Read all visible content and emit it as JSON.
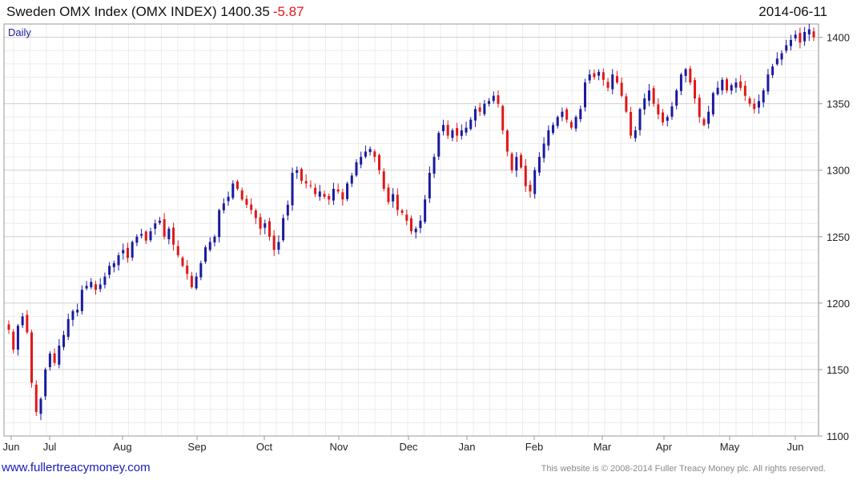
{
  "header": {
    "title": "Sweden OMX Index  (OMX INDEX) 1400.35",
    "change": "-5.87",
    "date": "2014-06-11"
  },
  "footer": {
    "link": "www.fullertreacymoney.com",
    "copyright": "This website is © 2008-2014 Fuller Treacy Money plc. All rights reserved."
  },
  "colors": {
    "up": "#1a1aa0",
    "down": "#e01818",
    "grid": "#d8d8d8",
    "frame": "#999999"
  },
  "chart_data": {
    "type": "candlestick",
    "period_label": "Daily",
    "ylim": [
      1100,
      1410
    ],
    "y_ticks": [
      1100,
      1150,
      1200,
      1250,
      1300,
      1350,
      1400
    ],
    "x_ticks": [
      "Jun",
      "Jul",
      "Aug",
      "Sep",
      "Oct",
      "Nov",
      "Dec",
      "Jan",
      "Feb",
      "Mar",
      "Apr",
      "May",
      "Jun"
    ],
    "grid": true,
    "note": "close values approximated from the plot",
    "closes": [
      1180,
      1165,
      1183,
      1190,
      1178,
      1140,
      1118,
      1128,
      1150,
      1162,
      1155,
      1168,
      1176,
      1188,
      1194,
      1195,
      1210,
      1213,
      1216,
      1210,
      1214,
      1220,
      1228,
      1230,
      1236,
      1240,
      1234,
      1246,
      1250,
      1252,
      1247,
      1254,
      1260,
      1262,
      1250,
      1256,
      1244,
      1236,
      1228,
      1222,
      1212,
      1220,
      1230,
      1242,
      1246,
      1250,
      1270,
      1275,
      1280,
      1290,
      1286,
      1278,
      1274,
      1270,
      1264,
      1256,
      1260,
      1250,
      1240,
      1246,
      1264,
      1274,
      1298,
      1300,
      1292,
      1290,
      1288,
      1282,
      1284,
      1280,
      1278,
      1286,
      1284,
      1278,
      1290,
      1296,
      1306,
      1310,
      1314,
      1316,
      1310,
      1300,
      1286,
      1276,
      1282,
      1270,
      1268,
      1262,
      1254,
      1256,
      1262,
      1278,
      1298,
      1310,
      1328,
      1334,
      1326,
      1330,
      1326,
      1330,
      1332,
      1338,
      1346,
      1344,
      1350,
      1352,
      1356,
      1350,
      1330,
      1314,
      1300,
      1310,
      1302,
      1288,
      1284,
      1300,
      1310,
      1320,
      1330,
      1334,
      1340,
      1344,
      1338,
      1332,
      1340,
      1346,
      1366,
      1372,
      1370,
      1374,
      1368,
      1362,
      1372,
      1366,
      1356,
      1344,
      1326,
      1330,
      1346,
      1354,
      1360,
      1350,
      1342,
      1336,
      1340,
      1348,
      1360,
      1372,
      1376,
      1366,
      1354,
      1340,
      1334,
      1344,
      1358,
      1362,
      1368,
      1360,
      1364,
      1366,
      1362,
      1356,
      1350,
      1346,
      1352,
      1360,
      1372,
      1378,
      1384,
      1388,
      1394,
      1398,
      1402,
      1396,
      1404,
      1406,
      1400
    ]
  }
}
